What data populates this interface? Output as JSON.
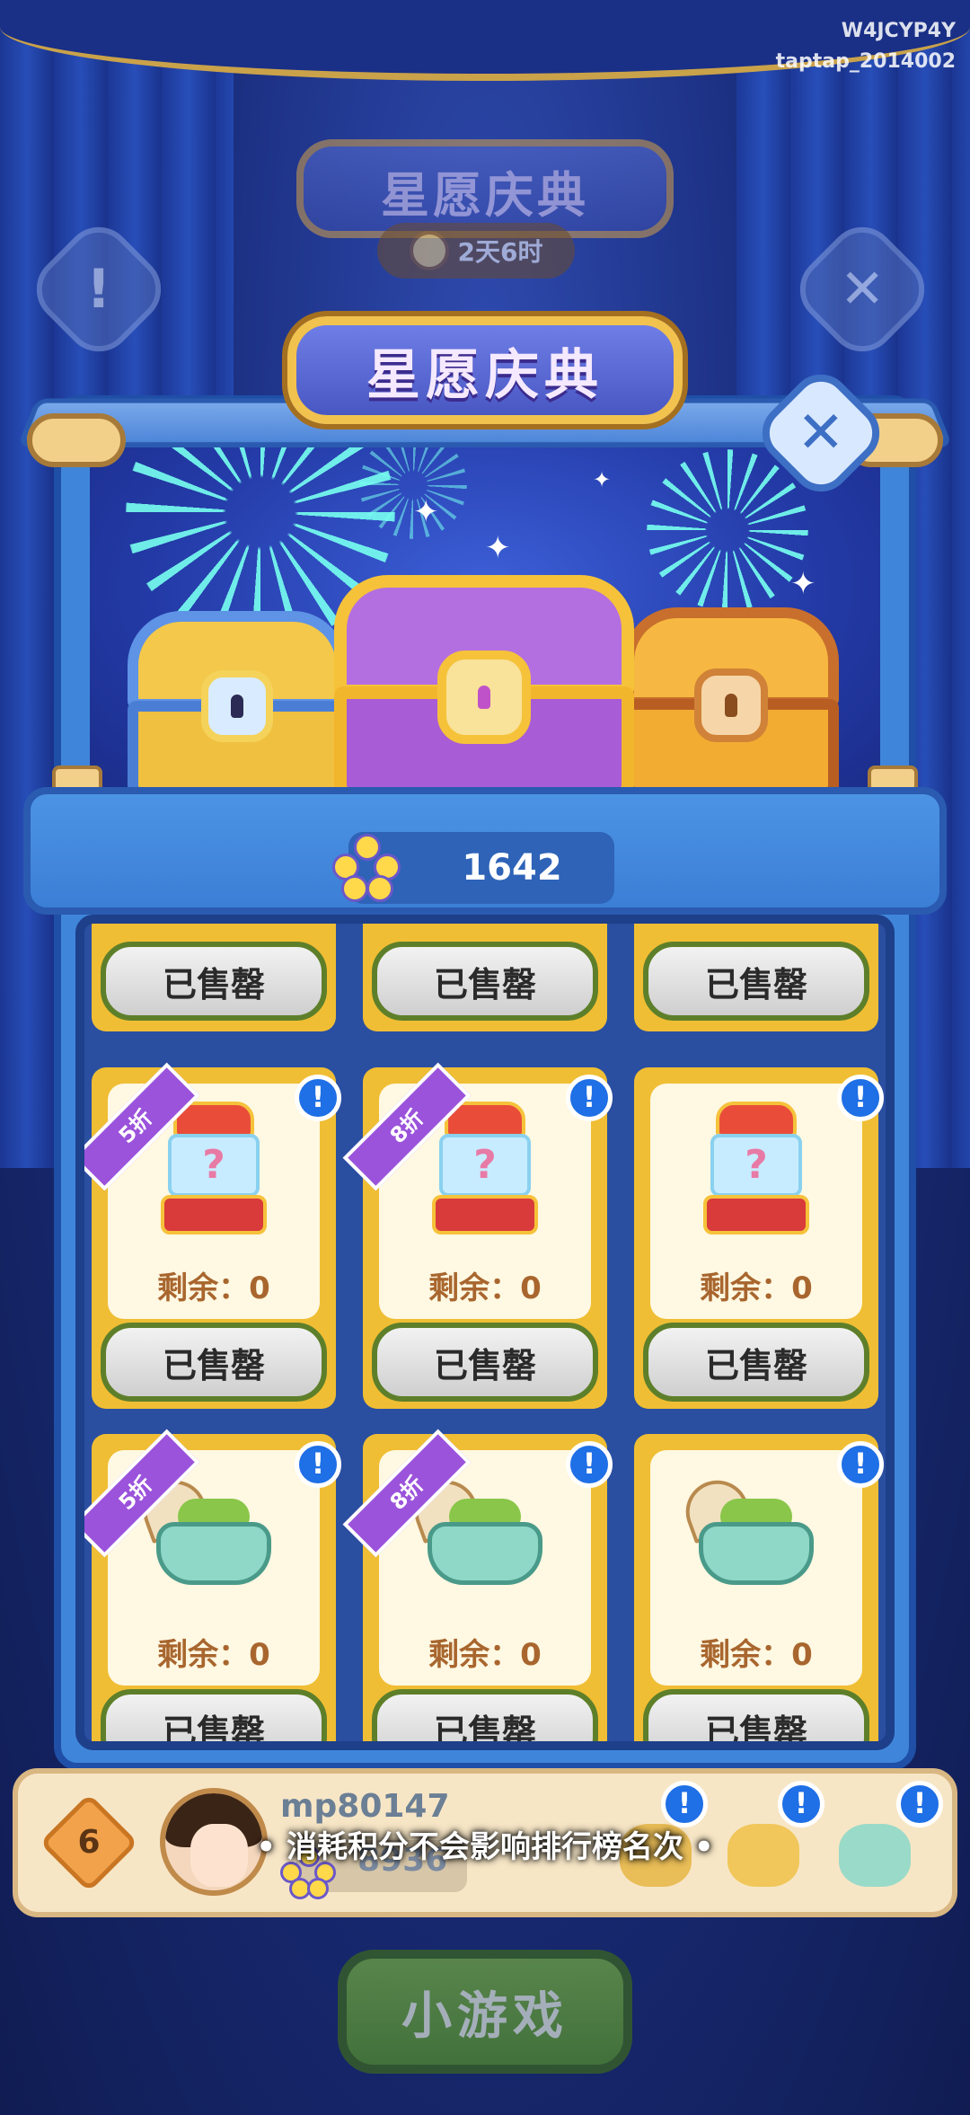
{
  "watermark": {
    "line1": "W4JCYP4Y",
    "line2": "taptap_2014002"
  },
  "background": {
    "banner_title": "星愿庆典",
    "timer": "2天6时",
    "info_glyph": "!",
    "close_glyph": "✕"
  },
  "modal": {
    "title": "星愿庆典",
    "close_glyph": "✕",
    "points_icon": "flower-coin-icon",
    "points": "1642"
  },
  "shop": {
    "sold_out_label": "已售罄",
    "info_glyph": "!",
    "top_row": [
      {
        "button": "已售罄"
      },
      {
        "button": "已售罄"
      },
      {
        "button": "已售罄"
      }
    ],
    "machine_row": [
      {
        "discount": "5折",
        "remaining": "剩余：0",
        "button": "已售罄",
        "item": "gacha-machine"
      },
      {
        "discount": "8折",
        "remaining": "剩余：0",
        "button": "已售罄",
        "item": "gacha-machine"
      },
      {
        "discount": "",
        "remaining": "剩余：0",
        "button": "已售罄",
        "item": "gacha-machine"
      }
    ],
    "pot_row": [
      {
        "discount": "5折",
        "remaining": "剩余：0",
        "button": "已售罄",
        "item": "treasure-pot"
      },
      {
        "discount": "8折",
        "remaining": "剩余：0",
        "button": "已售罄",
        "item": "treasure-pot"
      },
      {
        "discount": "",
        "remaining": "剩余：0",
        "button": "已售罄",
        "item": "treasure-pot"
      }
    ]
  },
  "player": {
    "rank": "6",
    "name": "mp80147",
    "score": "8936"
  },
  "toast": "• 消耗积分不会影响排行榜名次 •",
  "bottom_button": "小游戏",
  "colors": {
    "modal_blue": "#3f86db",
    "card_gold": "#f0be34",
    "discount_purple": "#9b53db",
    "info_blue": "#1f6fe6",
    "button_green": "#7cb83a"
  }
}
